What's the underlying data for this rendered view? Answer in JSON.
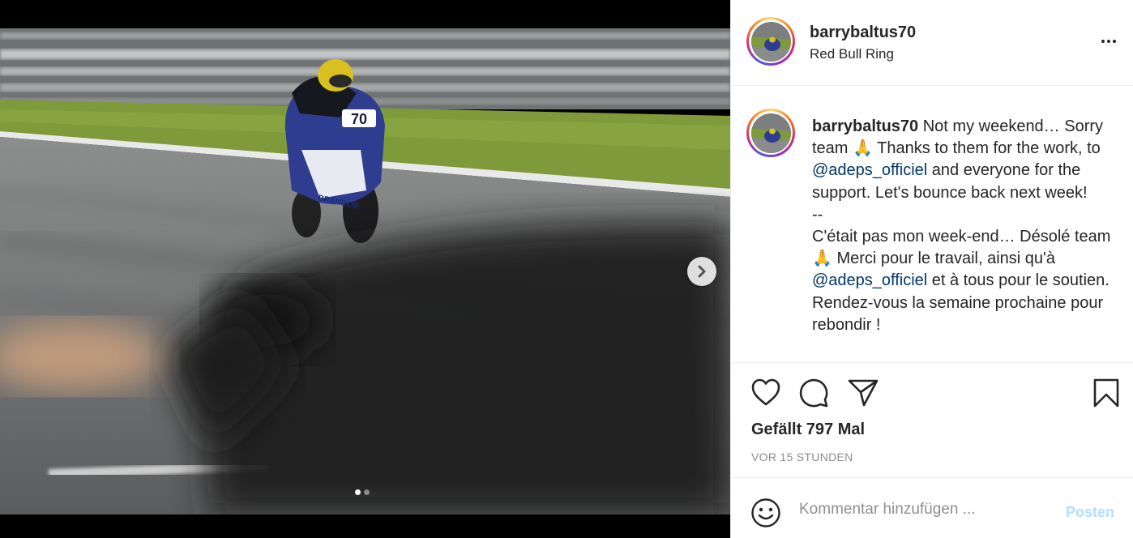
{
  "post": {
    "username": "barrybaltus70",
    "location": "Red Bull Ring",
    "bike_number": "70",
    "bike_sponsor": "BRANDLIE",
    "carousel": {
      "slides": 2,
      "active_slide": 1
    }
  },
  "caption": {
    "username": "barrybaltus70",
    "seg1": " Not my weekend… Sorry team ",
    "emoji1": "🙏",
    "seg2": " Thanks to them for the work, to ",
    "mention1": "@adeps_officiel",
    "seg3": " and everyone for the support. Let's bounce back next week!",
    "separator": "--",
    "seg4": "C'était pas mon week-end… Désolé team ",
    "emoji2": "🙏",
    "seg5": " Merci pour le travail, ainsi qu'à ",
    "mention2": "@adeps_officiel",
    "seg6": " et à tous pour le soutien. Rendez-vous la semaine prochaine pour rebondir !"
  },
  "actions": {
    "icons": [
      "heart-icon",
      "comment-icon",
      "share-icon",
      "bookmark-icon"
    ],
    "likes_text": "Gefällt 797 Mal",
    "timestamp": "VOR 15 STUNDEN"
  },
  "comment": {
    "placeholder": "Kommentar hinzufügen ...",
    "post_label": "Posten"
  },
  "colors": {
    "mention": "#00376b",
    "post_button_disabled": "#b2dffc",
    "secondary_text": "#8e8e8e",
    "divider": "#efefef"
  }
}
